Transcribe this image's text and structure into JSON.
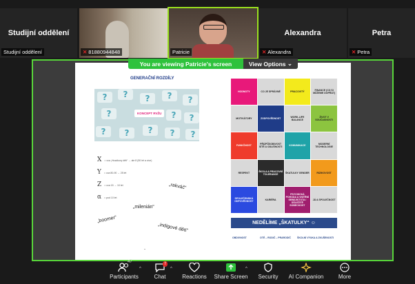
{
  "participants": [
    {
      "big_name": "Studijní oddělení",
      "tag": "Studijní oddělení",
      "muted": false
    },
    {
      "big_name": "",
      "tag": "81880944848",
      "muted": true
    },
    {
      "big_name": "",
      "tag": "Patricie",
      "muted": false
    },
    {
      "big_name": "Alexandra",
      "tag": "Alexandra",
      "muted": true
    },
    {
      "big_name": "Petra",
      "tag": "Petra",
      "muted": true
    }
  ],
  "banner": {
    "viewing": "You are viewing  Patricie's screen",
    "view_options": "View Options"
  },
  "slide": {
    "gen_title": "GENERAČNÍ ROZDÍLY",
    "image_label": "KONCEPT RVŽU",
    "generations": [
      {
        "letter": "X",
        "note": "= cca „Husákovy děti“ → ale 8 (50 let a více)"
      },
      {
        "letter": "Y",
        "note": "= cca 80-90 → 25 let"
      },
      {
        "letter": "Z",
        "note": "= cca 15 → 10 let"
      },
      {
        "letter": "α",
        "note": "= pod 10 let"
      }
    ],
    "quotes": {
      "rakvac": "„rakváč“",
      "milenian": "„milenián“",
      "boomer": "„boomer“",
      "indigove": "„indigové děti“"
    },
    "grid": [
      {
        "text": "HODNOTY",
        "color": "#e8197a"
      },
      {
        "text": "CO JE SPRÁVNÉ",
        "color": "#d9d9d9"
      },
      {
        "text": "PRACOVITÝ",
        "color": "#f3ea1c"
      },
      {
        "text": "FINANCE (CO SI MŮŽEME DOPŘÁT)",
        "color": "#d9d9d9"
      },
      {
        "text": "MOTIVÁTORY",
        "color": "#d9d9d9"
      },
      {
        "text": "ZODPOVĚDNOST",
        "color": "#1f3c88"
      },
      {
        "text": "WORK-LIFE BALANCE",
        "color": "#d9d9d9"
      },
      {
        "text": "ŽIVOT V SOUČASNOSTI",
        "color": "#8cc43f"
      },
      {
        "text": "FUNKČNOST",
        "color": "#ef3b2c"
      },
      {
        "text": "PŘIZPŮSOBIVOST SÍTĚ A ODLIŠNOSTI",
        "color": "#d9d9d9"
      },
      {
        "text": "KOMUNIKACE",
        "color": "#1fa3a8"
      },
      {
        "text": "MODERNÍ TECHNOLOGIE",
        "color": "#d9d9d9"
      },
      {
        "text": "RESPEKT",
        "color": "#d9d9d9"
      },
      {
        "text": "ŠKOLA A PRACOVNÍ TOLERANCE",
        "color": "#2b2b2b"
      },
      {
        "text": "ŠKATULKY GENDER",
        "color": "#d9d9d9"
      },
      {
        "text": "RIZIKOVOST",
        "color": "#f29a1c"
      },
      {
        "text": "SPOLEČENSKÁ ODPOVĚDNOST",
        "color": "#2b4ae0"
      },
      {
        "text": "KARIÉRA",
        "color": "#d9d9d9"
      },
      {
        "text": "PSYCHICKÁ POHODA A VNITŘNÍ SEBEJISTOTA / DŮLEŽITÉ SOBECKOST",
        "color": "#a01e6e"
      },
      {
        "text": "JÁ A SPOLEČNOST",
        "color": "#d9d9d9"
      }
    ],
    "nedelime": "NEDĚLÍME „ŠKATULKY“ ☺",
    "bottom_items": [
      "OBDIVNOST",
      "OTÉ – RODIČ – PRARODIČ",
      "ŠKOLNÍ VÝUKA A ZKUŠENOSTI"
    ]
  },
  "toolbar": {
    "participants_label": "Participants",
    "participants_count": "47",
    "chat_label": "Chat",
    "chat_badge": "7",
    "reactions_label": "Reactions",
    "share_label": "Share Screen",
    "security_label": "Security",
    "ai_label": "AI Companion",
    "more_label": "More"
  },
  "colors": {
    "share_green": "#2ec23c",
    "share_border": "#58d63a",
    "mute_red": "#e02828",
    "slide_blue": "#2b4a8b"
  }
}
